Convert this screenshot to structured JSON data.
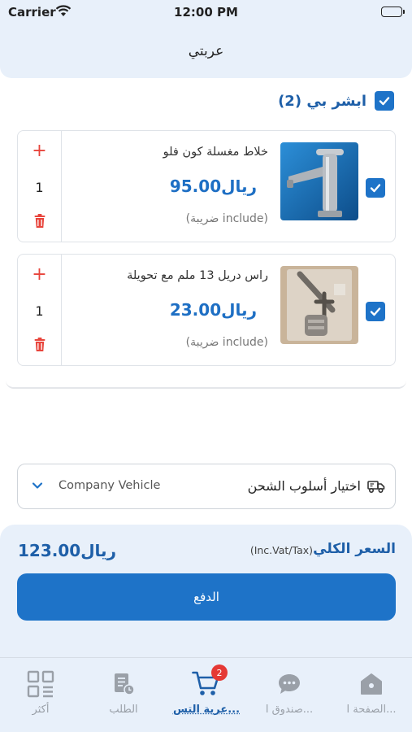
{
  "status_bar": {
    "carrier": "Carrier",
    "time": "12:00 PM"
  },
  "header": {
    "title": "عربتي"
  },
  "store": {
    "name": "ابشر بي (2)",
    "checked": true
  },
  "items": [
    {
      "name": "خلاط مغسلة كون فلو",
      "price": "ريال95.00",
      "tax_note": "(ضريبة include)",
      "quantity": "1",
      "checked": true,
      "image": "faucet"
    },
    {
      "name": "راس دريل 13 ملم مع تحويلة",
      "price": "ريال23.00",
      "tax_note": "(ضريبة include)",
      "quantity": "1",
      "checked": true,
      "image": "drill-chuck"
    }
  ],
  "shipping": {
    "label": "اختيار أسلوب الشحن",
    "selected": "Company Vehicle"
  },
  "summary": {
    "total_label": "السعر الكلي",
    "vat_note": "(Inc.Vat/Tax)",
    "total": "ريال123.00",
    "pay_label": "الدفع"
  },
  "tab_bar": {
    "items": [
      {
        "label": "أكثر",
        "icon": "grid-icon"
      },
      {
        "label": "الطلب",
        "icon": "orders-icon"
      },
      {
        "label": "عربة التس...",
        "icon": "cart-icon",
        "badge": "2",
        "active": true
      },
      {
        "label": "صندوق ا...",
        "icon": "chat-icon"
      },
      {
        "label": "الصفحة ا...",
        "icon": "home-icon"
      }
    ]
  },
  "colors": {
    "accent": "#1e73c8",
    "danger": "#e8453c",
    "panel": "#e8f0fa"
  }
}
